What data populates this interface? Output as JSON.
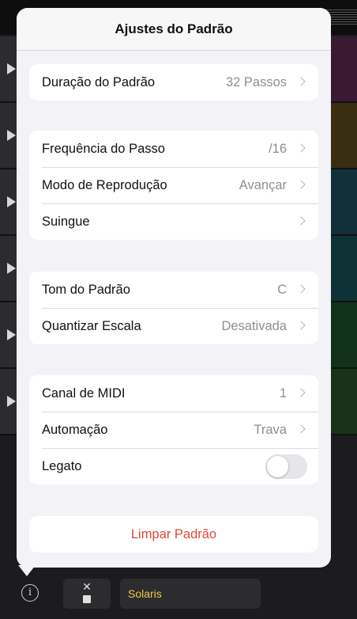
{
  "popover": {
    "title": "Ajustes do Padrão"
  },
  "groups": {
    "length": {
      "label": "Duração do Padrão",
      "value": "32 Passos"
    },
    "step": [
      {
        "label": "Frequência do Passo",
        "value": "/16"
      },
      {
        "label": "Modo de Reprodução",
        "value": "Avançar"
      },
      {
        "label": "Suingue",
        "value": ""
      }
    ],
    "pitch": [
      {
        "label": "Tom do Padrão",
        "value": "C"
      },
      {
        "label": "Quantizar Escala",
        "value": "Desativada"
      }
    ],
    "midi": [
      {
        "label": "Canal de MIDI",
        "value": "1"
      },
      {
        "label": "Automação",
        "value": "Trava"
      }
    ],
    "legato": {
      "label": "Legato",
      "enabled": false
    }
  },
  "actions": {
    "clear": "Limpar Padrão"
  },
  "bottombar": {
    "info_icon": "i",
    "name": "Solaris"
  },
  "colors": {
    "accent_red": "#e0483c",
    "lane_colors": [
      "#3a1a33",
      "#3a2e12",
      "#12303a",
      "#0f3236",
      "#12321a",
      "#1a321a"
    ]
  }
}
